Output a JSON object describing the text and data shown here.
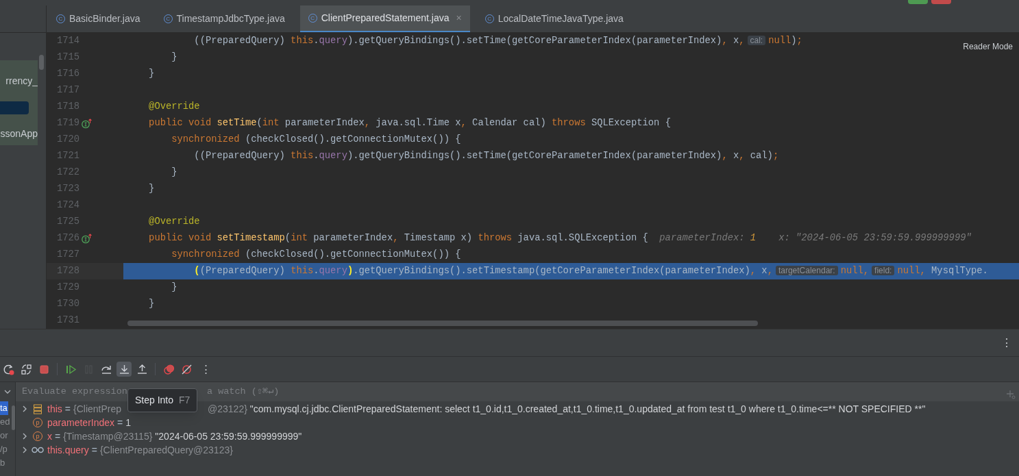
{
  "tabs": [
    {
      "label": "BasicBinder.java",
      "icon": "C",
      "selected": false
    },
    {
      "label": "TimestampJdbcType.java",
      "icon": "C",
      "selected": false
    },
    {
      "label": "ClientPreparedStatement.java",
      "icon": "C",
      "selected": true,
      "close": "×"
    },
    {
      "label": "LocalDateTimeJavaType.java",
      "icon": "C",
      "selected": false
    }
  ],
  "project_panel": {
    "items": [
      {
        "text": "rrency_",
        "selected": false
      },
      {
        "text": "ssonApp",
        "selected": false
      }
    ]
  },
  "editor": {
    "reader_mode": "Reader Mode",
    "lines": [
      {
        "number": "1714",
        "override": false,
        "current": false,
        "tokens": [
          {
            "kind": "plain",
            "text": "            ((PreparedQuery) "
          },
          {
            "kind": "kw",
            "text": "this"
          },
          {
            "kind": "plain",
            "text": "."
          },
          {
            "kind": "field",
            "text": "query"
          },
          {
            "kind": "plain",
            "text": ").getQueryBindings().setTime(getCoreParameterIndex(parameterIndex)"
          },
          {
            "kind": "kw",
            "text": ","
          },
          {
            "kind": "plain",
            "text": " x"
          },
          {
            "kind": "kw",
            "text": ","
          },
          {
            "kind": "inlay",
            "text": "cal:"
          },
          {
            "kind": "kw",
            "text": "null"
          },
          {
            "kind": "plain",
            "text": ")"
          },
          {
            "kind": "kw",
            "text": ";"
          }
        ]
      },
      {
        "number": "1715",
        "override": false,
        "current": false,
        "tokens": [
          {
            "kind": "plain",
            "text": "        }"
          }
        ]
      },
      {
        "number": "1716",
        "override": false,
        "current": false,
        "tokens": [
          {
            "kind": "plain",
            "text": "    }"
          }
        ]
      },
      {
        "number": "1717",
        "override": false,
        "current": false
      },
      {
        "number": "1718",
        "override": false,
        "current": false,
        "tokens": [
          {
            "kind": "annot",
            "text": "    @Override"
          }
        ]
      },
      {
        "number": "1719",
        "override": true,
        "current": false,
        "tokens": [
          {
            "kind": "kw",
            "text": "    public void "
          },
          {
            "kind": "fn",
            "text": "setTime"
          },
          {
            "kind": "plain",
            "text": "("
          },
          {
            "kind": "kw",
            "text": "int "
          },
          {
            "kind": "plain",
            "text": "parameterIndex"
          },
          {
            "kind": "kw",
            "text": ","
          },
          {
            "kind": "plain",
            "text": " java.sql.Time x"
          },
          {
            "kind": "kw",
            "text": ","
          },
          {
            "kind": "plain",
            "text": " Calendar cal) "
          },
          {
            "kind": "kw",
            "text": "throws "
          },
          {
            "kind": "plain",
            "text": "SQLException {"
          }
        ]
      },
      {
        "number": "1720",
        "override": false,
        "current": false,
        "tokens": [
          {
            "kind": "kw",
            "text": "        synchronized "
          },
          {
            "kind": "plain",
            "text": "(checkClosed().getConnectionMutex()) {"
          }
        ]
      },
      {
        "number": "1721",
        "override": false,
        "current": false,
        "tokens": [
          {
            "kind": "plain",
            "text": "            ((PreparedQuery) "
          },
          {
            "kind": "kw",
            "text": "this"
          },
          {
            "kind": "plain",
            "text": "."
          },
          {
            "kind": "field",
            "text": "query"
          },
          {
            "kind": "plain",
            "text": ").getQueryBindings().setTime(getCoreParameterIndex(parameterIndex)"
          },
          {
            "kind": "kw",
            "text": ","
          },
          {
            "kind": "plain",
            "text": " x"
          },
          {
            "kind": "kw",
            "text": ","
          },
          {
            "kind": "plain",
            "text": " cal)"
          },
          {
            "kind": "kw",
            "text": ";"
          }
        ]
      },
      {
        "number": "1722",
        "override": false,
        "current": false,
        "tokens": [
          {
            "kind": "plain",
            "text": "        }"
          }
        ]
      },
      {
        "number": "1723",
        "override": false,
        "current": false,
        "tokens": [
          {
            "kind": "plain",
            "text": "    }"
          }
        ]
      },
      {
        "number": "1724",
        "override": false,
        "current": false
      },
      {
        "number": "1725",
        "override": false,
        "current": false,
        "tokens": [
          {
            "kind": "annot",
            "text": "    @Override"
          }
        ]
      },
      {
        "number": "1726",
        "override": true,
        "current": false,
        "tokens": [
          {
            "kind": "kw",
            "text": "    public void "
          },
          {
            "kind": "fn",
            "text": "setTimestamp"
          },
          {
            "kind": "plain",
            "text": "("
          },
          {
            "kind": "kw",
            "text": "int "
          },
          {
            "kind": "plain",
            "text": "parameterIndex"
          },
          {
            "kind": "kw",
            "text": ","
          },
          {
            "kind": "plain",
            "text": " Timestamp x) "
          },
          {
            "kind": "kw",
            "text": "throws "
          },
          {
            "kind": "plain",
            "text": "java.sql.SQLException {  "
          },
          {
            "kind": "hint",
            "text": "parameterIndex: "
          },
          {
            "kind": "hintnum",
            "text": "1"
          },
          {
            "kind": "hint",
            "text": "    x: \"2024-06-05 23:59:59.999999999\""
          }
        ]
      },
      {
        "number": "1727",
        "override": false,
        "current": false,
        "tokens": [
          {
            "kind": "kw",
            "text": "        synchronized "
          },
          {
            "kind": "plain",
            "text": "(checkClosed().getConnectionMutex()) {"
          }
        ]
      },
      {
        "number": "1728",
        "override": false,
        "current": true,
        "tokens": [
          {
            "kind": "bracket",
            "text": "            ("
          },
          {
            "kind": "plain",
            "text": "(PreparedQuery) "
          },
          {
            "kind": "kw",
            "text": "this"
          },
          {
            "kind": "plain",
            "text": "."
          },
          {
            "kind": "field",
            "text": "query"
          },
          {
            "kind": "bracket",
            "text": ")"
          },
          {
            "kind": "plain",
            "text": ".getQueryBindings().setTimestamp(getCoreParameterIndex(parameterIndex)"
          },
          {
            "kind": "kw",
            "text": ","
          },
          {
            "kind": "plain",
            "text": " x"
          },
          {
            "kind": "kw",
            "text": ","
          },
          {
            "kind": "inlay",
            "text": "targetCalendar:"
          },
          {
            "kind": "kw",
            "text": "null"
          },
          {
            "kind": "kw",
            "text": ","
          },
          {
            "kind": "inlay",
            "text": "field:"
          },
          {
            "kind": "kw",
            "text": "null"
          },
          {
            "kind": "kw",
            "text": ","
          },
          {
            "kind": "plain",
            "text": " MysqlType."
          }
        ]
      },
      {
        "number": "1729",
        "override": false,
        "current": false,
        "tokens": [
          {
            "kind": "plain",
            "text": "        }"
          }
        ]
      },
      {
        "number": "1730",
        "override": false,
        "current": false,
        "tokens": [
          {
            "kind": "plain",
            "text": "    }"
          }
        ]
      },
      {
        "number": "1731",
        "override": false,
        "current": false
      }
    ]
  },
  "debugger": {
    "panel_menu": "⋮",
    "toolbar": [
      {
        "kind": "rerun",
        "disabled": false,
        "hovered": false
      },
      {
        "kind": "restore",
        "disabled": false,
        "hovered": false
      },
      {
        "kind": "stop",
        "disabled": false,
        "hovered": false
      },
      {
        "kind": "separator"
      },
      {
        "kind": "resume",
        "disabled": false,
        "hovered": false
      },
      {
        "kind": "pause",
        "disabled": true,
        "hovered": false
      },
      {
        "kind": "step_over",
        "disabled": false,
        "hovered": false
      },
      {
        "kind": "step_into",
        "disabled": false,
        "hovered": true
      },
      {
        "kind": "step_out",
        "disabled": false,
        "hovered": false
      },
      {
        "kind": "separator"
      },
      {
        "kind": "breakpoints",
        "disabled": false,
        "hovered": false
      },
      {
        "kind": "mute",
        "disabled": false,
        "hovered": false
      }
    ],
    "more": "⋮",
    "expression_placeholder": "Evaluate expression",
    "expression_placeholder_tail": "a watch (⇧⌘↵)",
    "tooltip": {
      "label": "Step Into",
      "shortcut": "F7"
    },
    "frames": [
      {
        "text": "ta",
        "selected": true
      },
      {
        "text": "ed",
        "selected": false
      },
      {
        "text": "or",
        "selected": false
      },
      {
        "text": "/p",
        "selected": false
      },
      {
        "text": "b",
        "selected": false
      }
    ],
    "variables": [
      {
        "kind": "object",
        "expandable": true,
        "name": "this",
        "eq": "=",
        "type": "{ClientPrep",
        "type_tail": "@23122}",
        "value": "\"com.mysql.cj.jdbc.ClientPreparedStatement: select t1_0.id,t1_0.created_at,t1_0.time,t1_0.updated_at from test t1_0 where t1_0.time<=** NOT SPECIFIED **\""
      },
      {
        "kind": "param",
        "icon": "p",
        "expandable": false,
        "name": "parameterIndex",
        "eq": "=",
        "value": "1"
      },
      {
        "kind": "param",
        "icon": "p",
        "expandable": true,
        "name": "x",
        "eq": "=",
        "type": "{Timestamp@23115}",
        "value": "\"2024-06-05 23:59:59.999999999\""
      },
      {
        "kind": "watch",
        "expandable": true,
        "name": "this.query",
        "eq": "=",
        "type": "{ClientPreparedQuery@23123}"
      }
    ]
  }
}
